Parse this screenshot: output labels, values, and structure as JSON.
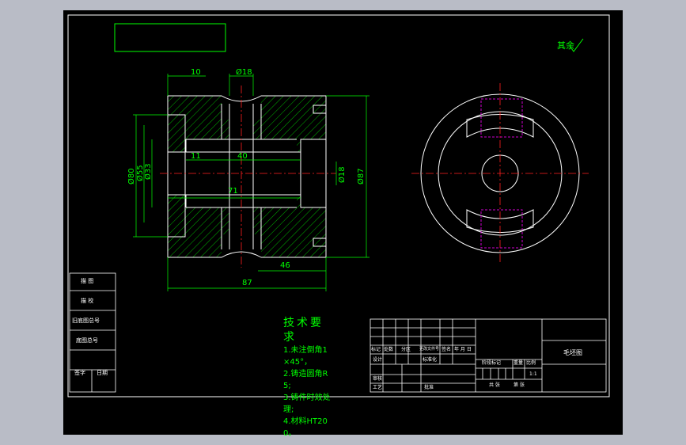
{
  "roughness": {
    "label": "其余"
  },
  "front_view_dims": {
    "top_10": "10",
    "top_d18": "Ø18",
    "h_11": "11",
    "h_40": "40",
    "h_71": "71",
    "h_46": "46",
    "h_87": "87",
    "v_d80": "Ø80",
    "v_d55": "Ø55",
    "v_d33": "Ø33",
    "v_d18": "Ø18",
    "v_d87": "Ø87"
  },
  "tech_requirements": {
    "title": "技术要求",
    "items": [
      "1.未注倒角1×45°，",
      "2.铸造圆角R5;",
      "3.铸件时效处理;",
      "4.材料HT200。"
    ]
  },
  "left_table": {
    "rows": [
      "描 图",
      "描 校",
      "旧底图总号",
      "底图总号",
      "签字",
      "日期"
    ]
  },
  "title_block": {
    "drawing_name": "毛坯图",
    "labels": {
      "mark": "标记",
      "count": "处数",
      "zone": "分区",
      "change_doc": "更改文件号",
      "sign": "签名",
      "date": "年 月 日",
      "design": "设计",
      "standardize": "标准化",
      "review": "审核",
      "process": "工艺",
      "approve": "批准",
      "stage_mark": "阶段标记",
      "weight": "重量",
      "scale": "比例",
      "scale_value": "1:1",
      "sheets_total": "共 张",
      "sheet_no": "第 张"
    }
  }
}
